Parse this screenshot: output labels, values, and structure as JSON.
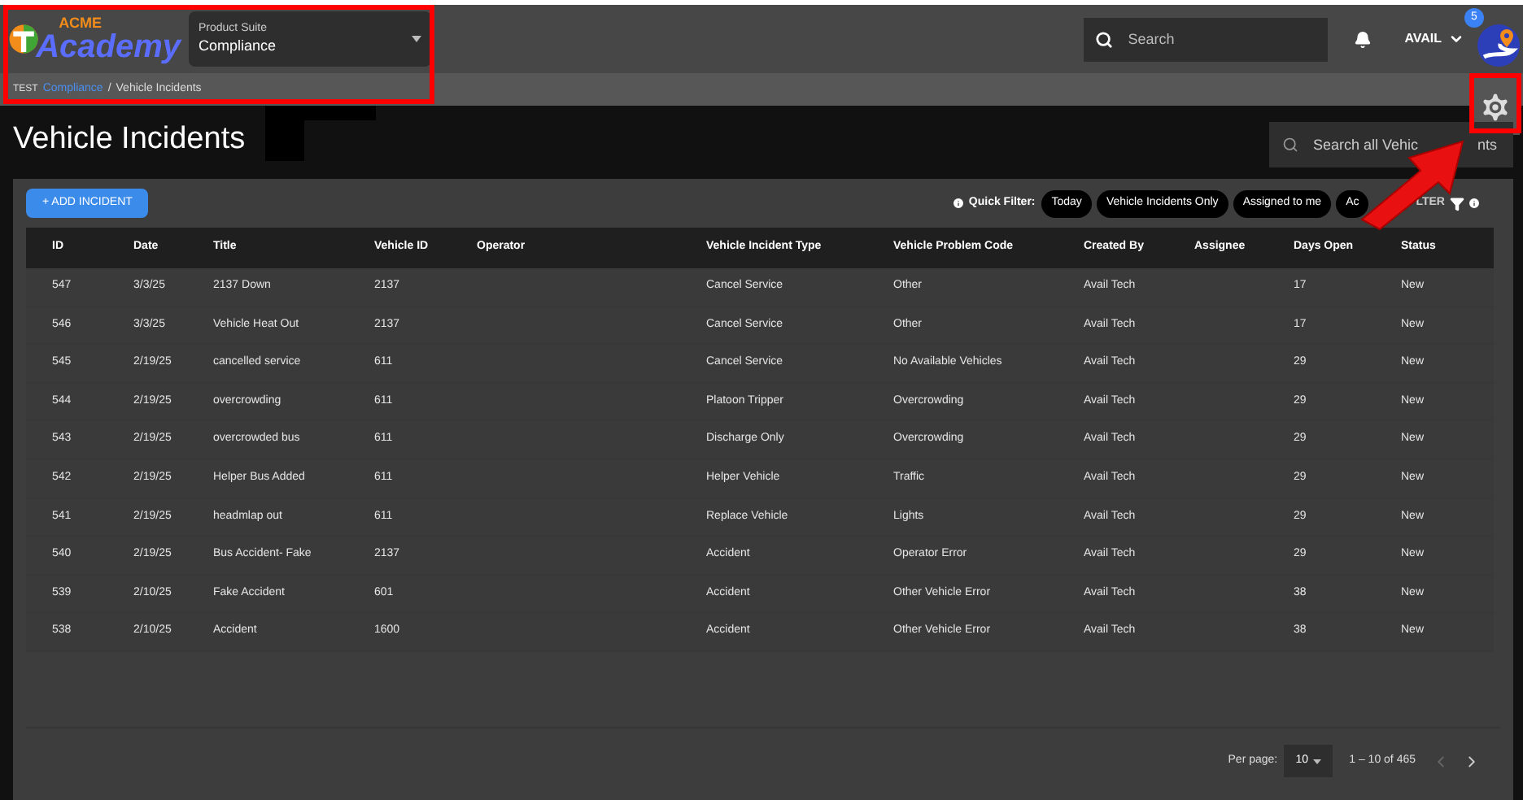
{
  "header": {
    "logo_small": "ACME",
    "logo_main": "Academy",
    "suite_label": "Product Suite",
    "suite_value": "Compliance",
    "search_placeholder": "Search",
    "user": "AVAIL",
    "badge": "5"
  },
  "breadcrumb": {
    "env": "TEST",
    "link": "Compliance",
    "separator": "/",
    "current": "Vehicle Incidents"
  },
  "page_title": "Vehicle Incidents",
  "search_all": {
    "placeholder": "Search all Vehic",
    "tail": "nts"
  },
  "add_button": "+ ADD INCIDENT",
  "quick_filter": {
    "label": "Quick Filter:",
    "chips": [
      "Today",
      "Vehicle Incidents Only",
      "Assigned to me",
      "Ac"
    ],
    "filter": "LTER"
  },
  "table": {
    "columns": [
      "ID",
      "Date",
      "Title",
      "Vehicle ID",
      "Operator",
      "Vehicle Incident Type",
      "Vehicle Problem Code",
      "Created By",
      "Assignee",
      "Days Open",
      "Status"
    ],
    "rows": [
      [
        "547",
        "3/3/25",
        "2137 Down",
        "2137",
        "",
        "Cancel Service",
        "Other",
        "Avail Tech",
        "",
        "17",
        "New"
      ],
      [
        "546",
        "3/3/25",
        "Vehicle Heat Out",
        "2137",
        "",
        "Cancel Service",
        "Other",
        "Avail Tech",
        "",
        "17",
        "New"
      ],
      [
        "545",
        "2/19/25",
        "cancelled service",
        "611",
        "",
        "Cancel Service",
        "No Available Vehicles",
        "Avail Tech",
        "",
        "29",
        "New"
      ],
      [
        "544",
        "2/19/25",
        "overcrowding",
        "611",
        "",
        "Platoon Tripper",
        "Overcrowding",
        "Avail Tech",
        "",
        "29",
        "New"
      ],
      [
        "543",
        "2/19/25",
        "overcrowded bus",
        "611",
        "",
        "Discharge Only",
        "Overcrowding",
        "Avail Tech",
        "",
        "29",
        "New"
      ],
      [
        "542",
        "2/19/25",
        "Helper Bus Added",
        "611",
        "",
        "Helper Vehicle",
        "Traffic",
        "Avail Tech",
        "",
        "29",
        "New"
      ],
      [
        "541",
        "2/19/25",
        "headmlap out",
        "611",
        "",
        "Replace Vehicle",
        "Lights",
        "Avail Tech",
        "",
        "29",
        "New"
      ],
      [
        "540",
        "2/19/25",
        "Bus Accident- Fake",
        "2137",
        "",
        "Accident",
        "Operator Error",
        "Avail Tech",
        "",
        "29",
        "New"
      ],
      [
        "539",
        "2/10/25",
        "Fake Accident",
        "601",
        "",
        "Accident",
        "Other Vehicle Error",
        "Avail Tech",
        "",
        "38",
        "New"
      ],
      [
        "538",
        "2/10/25",
        "Accident",
        "1600",
        "",
        "Accident",
        "Other Vehicle Error",
        "Avail Tech",
        "",
        "38",
        "New"
      ]
    ]
  },
  "pagination": {
    "label": "Per page:",
    "per_page": "10",
    "range": "1 – 10 of 465"
  }
}
